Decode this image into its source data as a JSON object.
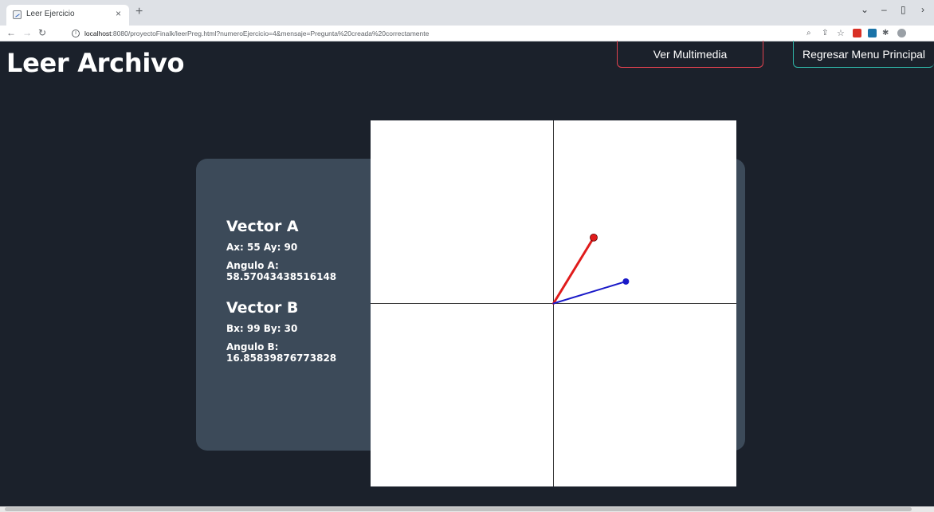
{
  "browser": {
    "tab_title": "Leer Ejercicio",
    "tab_close": "×",
    "new_tab": "+",
    "url_host": "localhost",
    "url_rest": ":8080/proyectoFinalk/leerPreg.html?numeroEjercicio=4&mensaje=Pregunta%20creada%20correctamente",
    "colors": {
      "tabbar": "#dee1e6"
    }
  },
  "page": {
    "title": "Leer Archivo",
    "buttons": {
      "media": "Ver Multimedia",
      "menu": "Regresar Menu Principal"
    }
  },
  "vectors": {
    "a": {
      "title": "Vector A",
      "components": "Ax: 55 Ay: 90",
      "angle_label": "Angulo A:",
      "angle_value": "58.57043438516148",
      "x": 55,
      "y": 90,
      "color": "#e01b1b"
    },
    "b": {
      "title": "Vector B",
      "components": "Bx: 99 By: 30",
      "angle_label": "Angulo B:",
      "angle_value": "16.85839876773828",
      "x": 99,
      "y": 30,
      "color": "#1a1ac8"
    }
  },
  "plot": {
    "range": [
      -250,
      250
    ]
  }
}
